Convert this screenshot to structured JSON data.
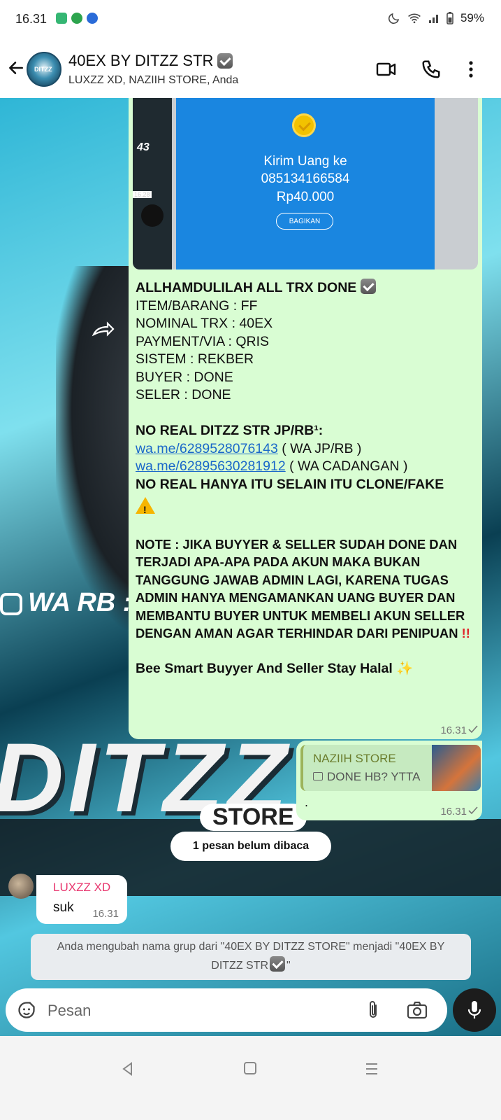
{
  "status_bar": {
    "time": "16.31",
    "battery": "59%"
  },
  "header": {
    "title": "40EX BY DITZZ STR",
    "subtitle": "LUXZZ XD, NAZIIH STORE, Anda",
    "avatar_text": "DITZZ"
  },
  "main_message": {
    "image": {
      "send_line1": "Kirim Uang ke",
      "phone": "085134166584",
      "amount": "Rp40.000",
      "share_label": "BAGIKAN",
      "side_time": "16.28",
      "side_number": "43"
    },
    "heading": "ALLHAMDULILAH ALL TRX DONE",
    "lines": [
      "ITEM/BARANG : FF",
      "NOMINAL TRX : 40EX",
      "PAYMENT/VIA : QRIS",
      "SISTEM : REKBER",
      "BUYER : DONE",
      "SELER : DONE"
    ],
    "real_heading": "NO REAL DITZZ STR JP/RB¹:",
    "link1": "wa.me/6289528076143",
    "link1_note": " ( WA JP/RB )",
    "link2": "wa.me/62895630281912",
    "link2_note": " ( WA CADANGAN )",
    "warning": "NO REAL HANYA ITU SELAIN ITU CLONE/FAKE",
    "note": "NOTE : JIKA BUYYER & SELLER SUDAH DONE DAN TERJADI APA-APA PADA AKUN MAKA BUKAN TANGGUNG JAWAB ADMIN LAGI, KARENA TUGAS ADMIN HANYA MENGAMANKAN UANG BUYER DAN MEMBANTU BUYER UNTUK MEMBELI AKUN SELLER DENGAN AMAN AGAR TERHINDAR DARI PENIPUAN",
    "closing": "Bee Smart Buyyer And Seller Stay Halal",
    "time": "16.31"
  },
  "reply_message": {
    "quoted_name": "NAZIIH STORE",
    "quoted_text": "DONE HB? YTTA",
    "body": ".",
    "time": "16.31"
  },
  "unread_banner": "1 pesan belum dibaca",
  "incoming_message": {
    "sender": "LUXZZ XD",
    "text": "suk",
    "time": "16.31"
  },
  "system_note": {
    "text1": "Anda mengubah nama grup dari \"40EX BY DITZZ STORE\" menjadi \"40EX BY",
    "text2": "DITZZ STR",
    "text3": "\""
  },
  "wallpaper": {
    "top_text": "WA RB :",
    "logo_text": "DITZZ",
    "sub_text": "STORE"
  },
  "input": {
    "placeholder": "Pesan",
    "value": ""
  },
  "colors": {
    "bubble_out": "#d9fdd3",
    "link": "#1a68c9",
    "sender_name": "#e8366e",
    "quote_name": "#6b7d2d"
  }
}
